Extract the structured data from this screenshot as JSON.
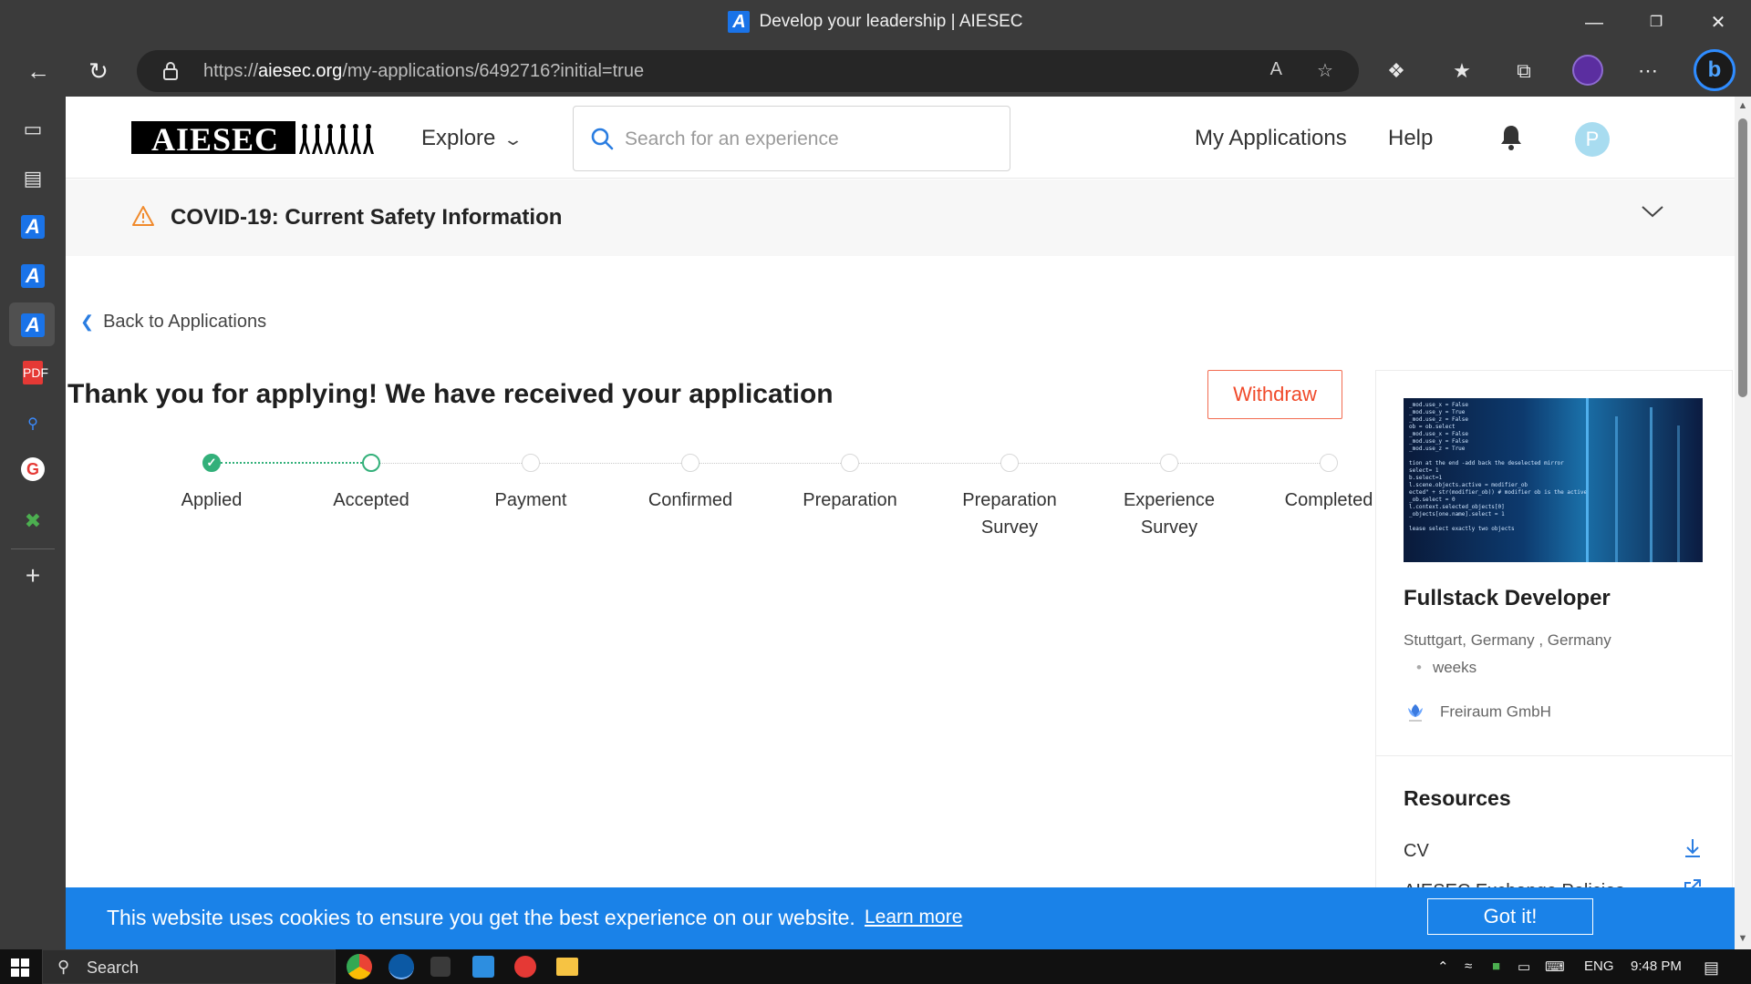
{
  "browser": {
    "tab_title": "Develop your leadership | AIESEC",
    "url_prefix": "https://",
    "url_host": "aiesec.org",
    "url_path": "/my-applications/6492716?initial=true"
  },
  "site": {
    "logo_text": "AIESEC",
    "nav": {
      "explore_label": "Explore",
      "search_placeholder": "Search for an experience",
      "my_applications_label": "My Applications",
      "help_label": "Help",
      "avatar_initial": "P"
    },
    "covid_banner": "COVID-19: Current Safety Information"
  },
  "application": {
    "back_label": "Back to Applications",
    "headline": "Thank you for applying! We have received your application",
    "withdraw_label": "Withdraw",
    "steps": [
      {
        "label": "Applied",
        "state": "done"
      },
      {
        "label": "Accepted",
        "state": "current"
      },
      {
        "label": "Payment",
        "state": "pending"
      },
      {
        "label": "Confirmed",
        "state": "pending"
      },
      {
        "label": "Preparation",
        "state": "pending"
      },
      {
        "label": "Preparation Survey",
        "state": "pending"
      },
      {
        "label": "Experience Survey",
        "state": "pending"
      },
      {
        "label": "Completed",
        "state": "pending"
      }
    ]
  },
  "opportunity": {
    "title": "Fullstack Developer",
    "location": "Stuttgart, Germany , Germany",
    "duration": "weeks",
    "organization": "Freiraum GmbH",
    "resources_heading": "Resources",
    "resources": [
      {
        "label": "CV",
        "icon": "download-icon"
      },
      {
        "label": "AIESEC Exchange Policies",
        "icon": "external-link-icon"
      }
    ]
  },
  "cookie_banner": {
    "message": "This website uses cookies to ensure you get the best experience on our website.",
    "learn_more": "Learn more",
    "accept": "Got it!"
  },
  "taskbar": {
    "search_label": "Search",
    "language": "ENG",
    "time": "9:48 PM"
  },
  "colors": {
    "accent_blue": "#1a82e8",
    "success_green": "#33b07a",
    "withdraw_red": "#f04a2a"
  }
}
